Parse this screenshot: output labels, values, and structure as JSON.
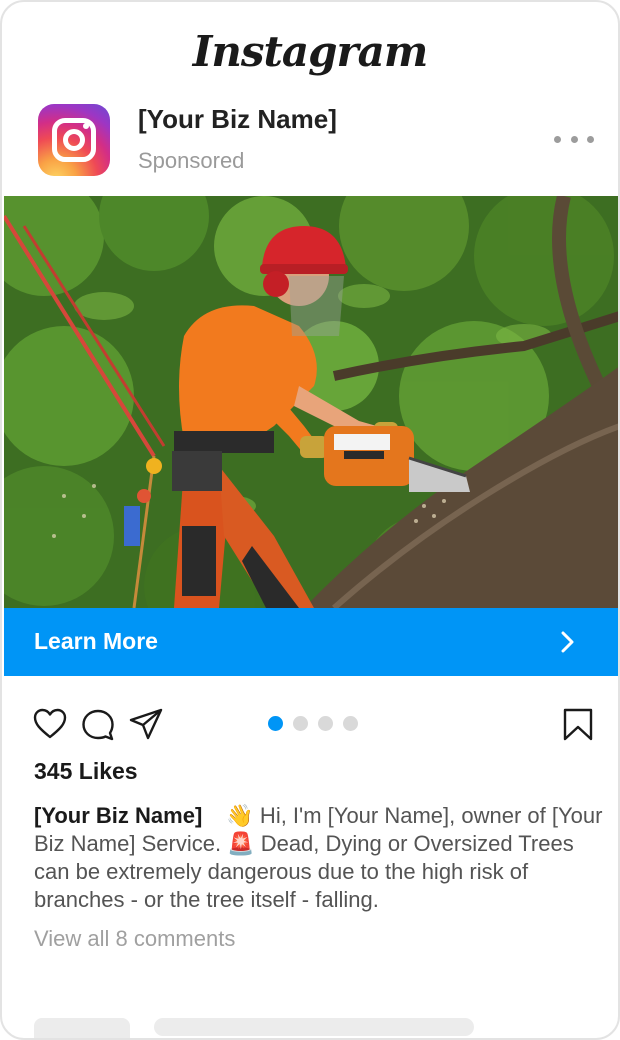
{
  "app": {
    "wordmark": "Instagram"
  },
  "post": {
    "account_name": "[Your Biz Name]",
    "sponsored_label": "Sponsored",
    "image_alt": "Arborist in orange shirt and red helmet cutting a tree branch with a chainsaw",
    "cta_label": "Learn More",
    "carousel": {
      "total": 4,
      "active_index": 0
    },
    "likes": "345 Likes",
    "caption": {
      "account_name": "[Your Biz Name]",
      "wave_emoji": "👋",
      "text_1": " Hi, I'm [Your Name], owner of [Your Biz Name] Service. ",
      "siren_emoji": "🚨",
      "text_2": " Dead, Dying or Oversized Trees can be extremely dangerous due to the high risk of branches - or the tree itself - falling."
    },
    "comments_link": "View all 8 comments"
  },
  "icons": {
    "avatar": "instagram-logo-icon",
    "more": "more-horizontal-icon",
    "like": "heart-icon",
    "comment": "comment-icon",
    "share": "send-icon",
    "save": "bookmark-icon",
    "cta": "chevron-right-icon"
  },
  "colors": {
    "accent": "#0095f6",
    "inactive_dot": "#d9d9d9",
    "text_primary": "#1a1a1a",
    "text_secondary": "#545454",
    "text_muted": "#9a9a9a"
  }
}
